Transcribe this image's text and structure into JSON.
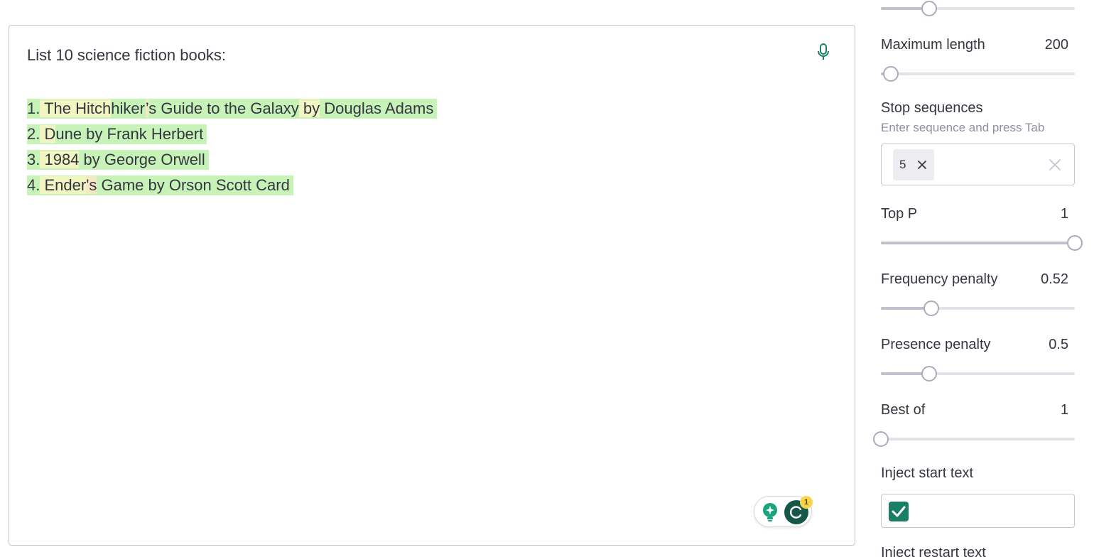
{
  "editor": {
    "prompt": "List 10 science fiction books:",
    "completion_lines": [
      [
        {
          "t": "1.",
          "c": "g"
        },
        {
          "t": " The",
          "c": "y"
        },
        {
          "t": " Hitch",
          "c": "y"
        },
        {
          "t": "hiker",
          "c": "g"
        },
        {
          "t": "’",
          "c": "o"
        },
        {
          "t": "s Guide to the Galaxy",
          "c": "g"
        },
        {
          "t": " by",
          "c": "y"
        },
        {
          "t": " Douglas Adams",
          "c": "g"
        }
      ],
      [
        {
          "t": "2.",
          "c": "g"
        },
        {
          "t": " D",
          "c": "y"
        },
        {
          "t": "une by Frank Herbert",
          "c": "g"
        }
      ],
      [
        {
          "t": "3.",
          "c": "g"
        },
        {
          "t": " 1984",
          "c": "y"
        },
        {
          "t": " by George Orwell",
          "c": "g"
        }
      ],
      [
        {
          "t": "4.",
          "c": "g"
        },
        {
          "t": " Ender",
          "c": "y"
        },
        {
          "t": "'s",
          "c": "o"
        },
        {
          "t": " Game by Orson Scott Card",
          "c": "g"
        }
      ]
    ],
    "assistant_badge_count": "1",
    "token_colors": {
      "g": "#c7f2b8",
      "y": "#f1f5c2",
      "o": "#f6e8c4"
    }
  },
  "settings": {
    "top_slider": {
      "fraction": 0.25
    },
    "maximum_length": {
      "label": "Maximum length",
      "value": "200",
      "fraction": 0.05
    },
    "stop_sequences": {
      "label": "Stop sequences",
      "hint": "Enter sequence and press Tab",
      "chips": [
        "5"
      ]
    },
    "top_p": {
      "label": "Top P",
      "value": "1",
      "fraction": 1.0
    },
    "frequency_penalty": {
      "label": "Frequency penalty",
      "value": "0.52",
      "fraction": 0.26
    },
    "presence_penalty": {
      "label": "Presence penalty",
      "value": "0.5",
      "fraction": 0.25
    },
    "best_of": {
      "label": "Best of",
      "value": "1",
      "fraction": 0.0
    },
    "inject_start_text": {
      "label": "Inject start text",
      "checked": true
    },
    "inject_restart_text": {
      "label": "Inject restart text"
    }
  },
  "colors": {
    "accent": "#1a7f64",
    "track": "#e2e2e8",
    "track_fill": "#c1c0cd"
  }
}
